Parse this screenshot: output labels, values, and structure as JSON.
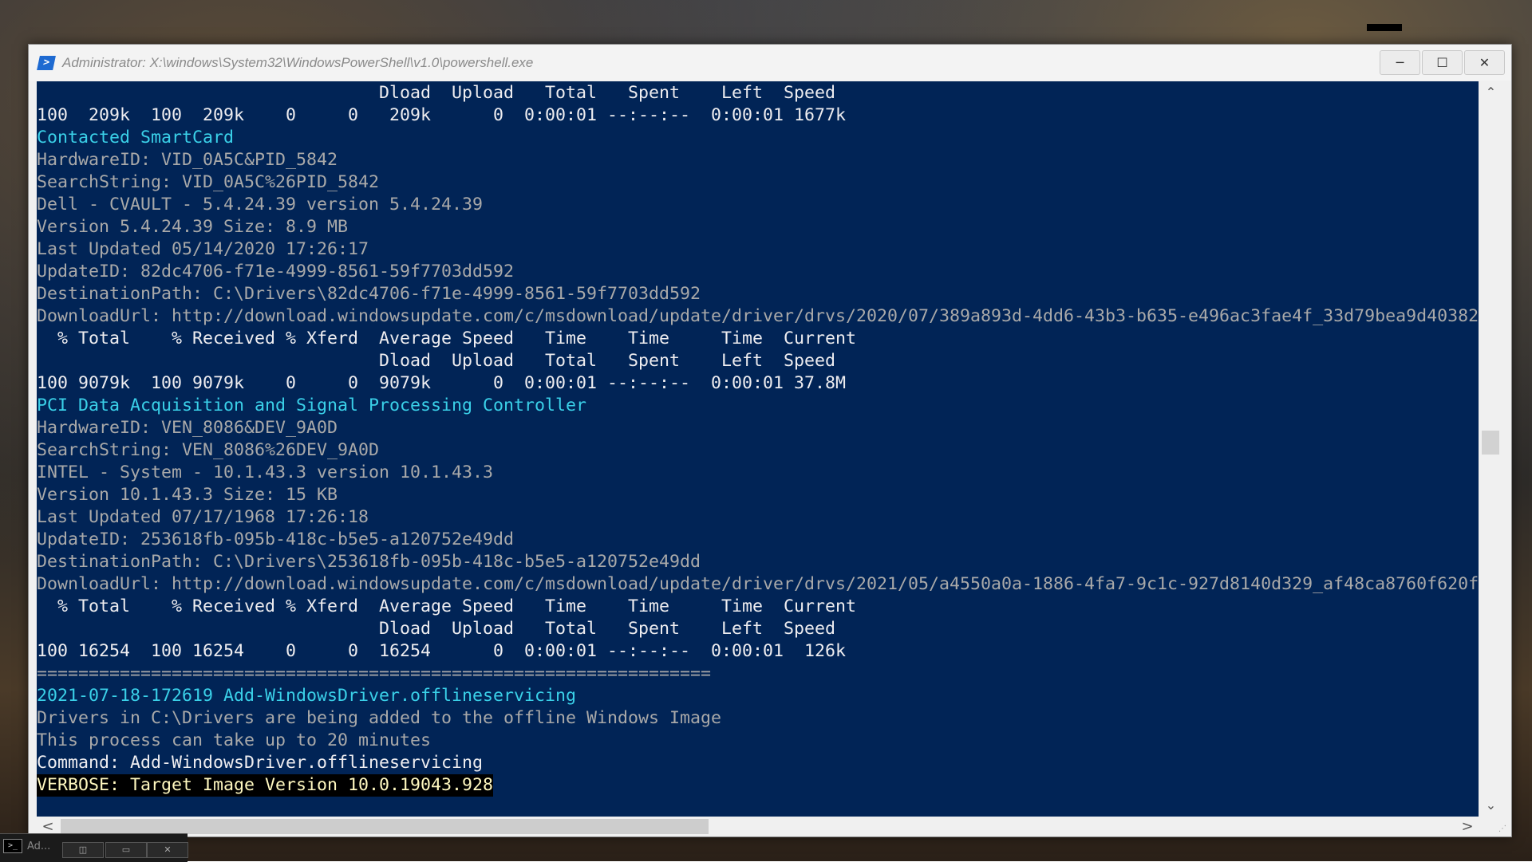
{
  "window": {
    "title": "Administrator: X:\\windows\\System32\\WindowsPowerShell\\v1.0\\powershell.exe",
    "buttons": {
      "minimize": "─",
      "maximize": "☐",
      "close": "✕"
    }
  },
  "console": {
    "background": "#012456",
    "lines": [
      "                                 Dload  Upload   Total   Spent    Left  Speed",
      "100  209k  100  209k    0     0   209k      0  0:00:01 --:--:--  0:00:01 1677k",
      "Contacted SmartCard",
      "HardwareID: VID_0A5C&PID_5842",
      "SearchString: VID_0A5C%26PID_5842",
      "Dell - CVAULT - 5.4.24.39 version 5.4.24.39",
      "Version 5.4.24.39 Size: 8.9 MB",
      "Last Updated 05/14/2020 17:26:17",
      "UpdateID: 82dc4706-f71e-4999-8561-59f7703dd592",
      "DestinationPath: C:\\Drivers\\82dc4706-f71e-4999-8561-59f7703dd592",
      "DownloadUrl: http://download.windowsupdate.com/c/msdownload/update/driver/drvs/2020/07/389a893d-4dd6-43b3-b635-e496ac3fae4f_33d79bea9d40382",
      "  % Total    % Received % Xferd  Average Speed   Time    Time     Time  Current",
      "                                 Dload  Upload   Total   Spent    Left  Speed",
      "100 9079k  100 9079k    0     0  9079k      0  0:00:01 --:--:--  0:00:01 37.8M",
      "PCI Data Acquisition and Signal Processing Controller",
      "HardwareID: VEN_8086&DEV_9A0D",
      "SearchString: VEN_8086%26DEV_9A0D",
      "INTEL - System - 10.1.43.3 version 10.1.43.3",
      "Version 10.1.43.3 Size: 15 KB",
      "Last Updated 07/17/1968 17:26:18",
      "UpdateID: 253618fb-095b-418c-b5e5-a120752e49dd",
      "DestinationPath: C:\\Drivers\\253618fb-095b-418c-b5e5-a120752e49dd",
      "DownloadUrl: http://download.windowsupdate.com/c/msdownload/update/driver/drvs/2021/05/a4550a0a-1886-4fa7-9c1c-927d8140d329_af48ca8760f620f",
      "  % Total    % Received % Xferd  Average Speed   Time    Time     Time  Current",
      "                                 Dload  Upload   Total   Spent    Left  Speed",
      "100 16254  100 16254    0     0  16254      0  0:00:01 --:--:--  0:00:01  126k",
      "=================================================================",
      "2021-07-18-172619 Add-WindowsDriver.offlineservicing",
      "Drivers in C:\\Drivers are being added to the offline Windows Image",
      "This process can take up to 20 minutes",
      "Command: Add-WindowsDriver.offlineservicing",
      "VERBOSE: Target Image Version 10.0.19043.928"
    ]
  },
  "scrollbars": {
    "up": "⌃",
    "down": "⌄",
    "left": "<",
    "right": ">"
  },
  "taskbar": {
    "label": "Ad..."
  }
}
